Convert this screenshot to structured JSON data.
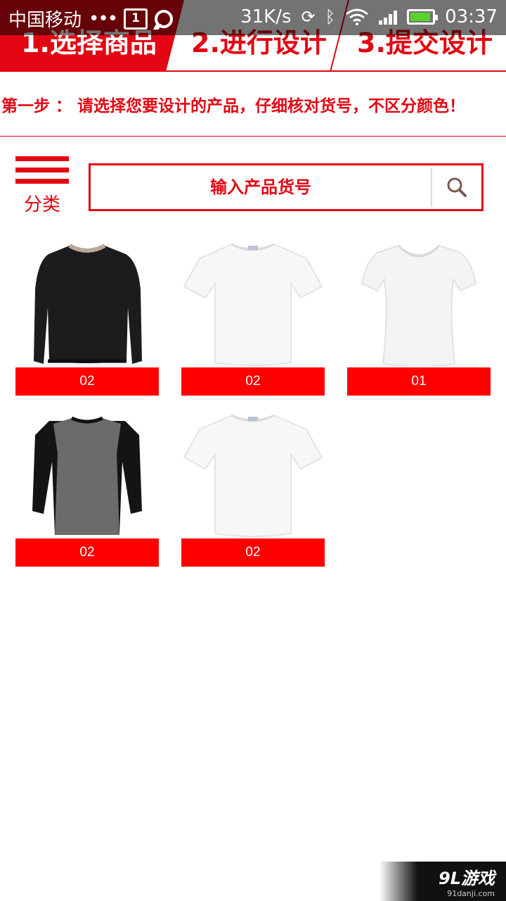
{
  "status_bar": {
    "carrier": "中国移动",
    "dots": "•••",
    "calendar_day": "1",
    "speed": "31K/s",
    "time": "03:37"
  },
  "steps": [
    {
      "label": "1.选择商品",
      "active": true
    },
    {
      "label": "2.进行设计",
      "active": false
    },
    {
      "label": "3.提交设计",
      "active": false
    }
  ],
  "instruction": "第一步 ： 请选择您要设计的产品，仔细核对货号，不区分颜色！",
  "menu": {
    "label": "分类"
  },
  "search": {
    "placeholder": "输入产品货号"
  },
  "products": [
    {
      "label": "02",
      "image": "black-cropped-sweater"
    },
    {
      "label": "02",
      "image": "white-tshirt"
    },
    {
      "label": "01",
      "image": "white-womens-tshirt"
    },
    {
      "label": "02",
      "image": "gray-raglan-shirt"
    },
    {
      "label": "02",
      "image": "white-tshirt"
    }
  ],
  "watermark": {
    "main": "9L游戏",
    "sub": "91danji.com"
  },
  "colors": {
    "accent": "#e30613",
    "label_bg": "#ff0000"
  }
}
